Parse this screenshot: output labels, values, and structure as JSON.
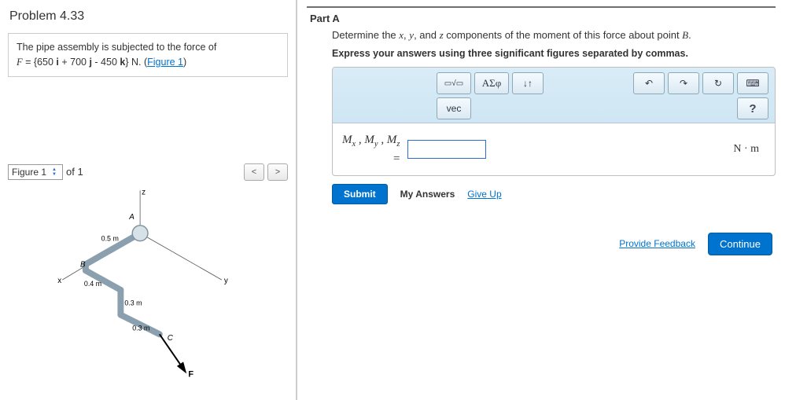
{
  "problem": {
    "title": "Problem 4.33",
    "statement_prefix": "The pipe assembly is subjected to the force of ",
    "force_expr_html": "<span class='it'>F</span> = {650 <span class='bvec'>i</span> + 700 <span class='bvec'>j</span> - 450 <span class='bvec'>k</span>} N.",
    "figure_link_text": "Figure 1",
    "figure_link_open": " (",
    "figure_link_close": ")"
  },
  "figure": {
    "selector_label": "Figure 1",
    "of_text": "of 1",
    "dims": {
      "d1": "0.5 m",
      "d2": "0.4 m",
      "d3": "0.3 m",
      "d4": "0.3 m"
    },
    "points": {
      "A": "A",
      "B": "B",
      "C": "C",
      "F": "F"
    },
    "axes": {
      "x": "x",
      "y": "y",
      "z": "z"
    }
  },
  "partA": {
    "heading": "Part A",
    "question_html": "Determine the <span class='it'>x</span>, <span class='it'>y</span>, and <span class='it'>z</span> components of the moment of this force about point <span class='it'>B</span>.",
    "instruction": "Express your answers using three significant figures separated by commas.",
    "lhs_html": "<span>M<sub>x</sub> , M<sub>y</sub> , M<sub>z</sub></span><span class='eq'>=</span>",
    "units_html": "N · m",
    "answer_value": "",
    "submit": "Submit",
    "my_answers": "My Answers",
    "give_up": "Give Up",
    "toolbar": {
      "templates": "▭√▭",
      "greek": "ΑΣφ",
      "updown": "↓↑",
      "undo": "↶",
      "redo": "↷",
      "reset": "↻",
      "keyboard": "⌨",
      "vec": "vec",
      "help": "?"
    }
  },
  "footer": {
    "feedback": "Provide Feedback",
    "continue": "Continue"
  }
}
